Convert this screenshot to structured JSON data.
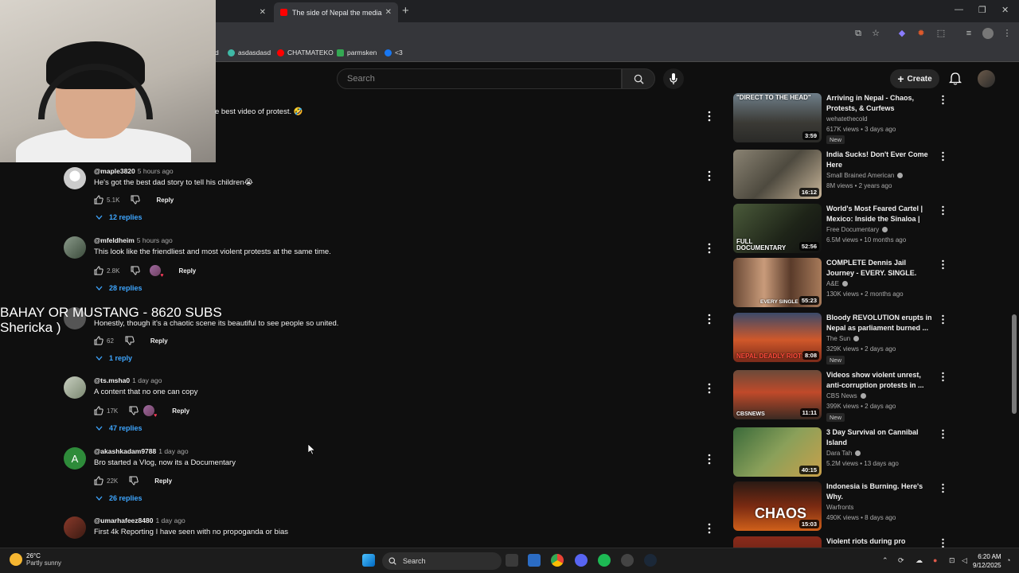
{
  "browser": {
    "tabs": [
      {
        "title": "",
        "active": false
      },
      {
        "title": "The side of Nepal the media w",
        "active": true
      }
    ],
    "bookmarks": [
      {
        "label": "d"
      },
      {
        "label": "asdasdasd"
      },
      {
        "label": "CHATMATEKO"
      },
      {
        "label": "parmsken"
      },
      {
        "label": "<3"
      }
    ]
  },
  "youtube": {
    "search_placeholder": "Search",
    "create_label": "Create"
  },
  "overlay": {
    "line1": "BAHAY OR MUSTANG - 8620 SUBS",
    "line2": "Shericka )"
  },
  "comments": [
    {
      "handle": "",
      "time": "",
      "text": "e best video of protest. 🤣",
      "likes": "",
      "replies": ""
    },
    {
      "handle": "@maple3820",
      "time": "5 hours ago",
      "text": "He's got the best dad story to tell his children😭",
      "likes": "5.1K",
      "replies": "12 replies"
    },
    {
      "handle": "@mfeldheim",
      "time": "5 hours ago",
      "text": "This look like the friendliest and most violent protests at the same time.",
      "likes": "2.8K",
      "replies": "28 replies"
    },
    {
      "handle": "",
      "time": "",
      "text": "Honestly, though it's a chaotic scene its beautiful to see people so united.",
      "likes": "62",
      "replies": "1 reply"
    },
    {
      "handle": "@ts.msha0",
      "time": "1 day ago",
      "text": "A content that no one can copy",
      "likes": "17K",
      "replies": "47 replies"
    },
    {
      "handle": "@akashkadam9788",
      "time": "1 day ago",
      "text": "Bro started a Vlog, now its a Documentary",
      "likes": "22K",
      "replies": "26 replies"
    },
    {
      "handle": "@umarhafeez8480",
      "time": "1 day ago",
      "text": "First 4k Reporting I have seen with no propoganda or bias",
      "likes": "",
      "replies": ""
    }
  ],
  "reply_label": "Reply",
  "sidebar_videos": [
    {
      "title": "Arriving in Nepal - Chaos, Protests, & Curfews",
      "channel": "wehatethecold",
      "meta": "617K views • 3 days ago",
      "new": "New",
      "duration": "3:59",
      "caption": "\"DIRECT TO THE HEAD\""
    },
    {
      "title": "India Sucks! Don't Ever Come Here",
      "channel": "Small Brained American",
      "meta": "8M views • 2 years ago",
      "new": "",
      "duration": "16:12",
      "caption": ""
    },
    {
      "title": "World's Most Feared Cartel | Mexico: Inside the Sinaloa | Fr...",
      "channel": "Free Documentary",
      "meta": "6.5M views • 10 months ago",
      "new": "",
      "duration": "52:56",
      "caption": "FULL DOCUMENTARY"
    },
    {
      "title": "COMPLETE Dennis Jail Journey - EVERY. SINGLE. SCENE. - Par...",
      "channel": "A&E",
      "meta": "130K views • 2 months ago",
      "new": "",
      "duration": "55:23",
      "caption": "EVERY SINGLE"
    },
    {
      "title": "Bloody REVOLUTION erupts in Nepal as parliament burned ...",
      "channel": "The Sun",
      "meta": "329K views • 2 days ago",
      "new": "New",
      "duration": "8:08",
      "caption": "NEPAL DEADLY RIOTS"
    },
    {
      "title": "Videos show violent unrest, anti-corruption protests in ...",
      "channel": "CBS News",
      "meta": "399K views • 2 days ago",
      "new": "New",
      "duration": "11:11",
      "caption": "CBSNEWS"
    },
    {
      "title": "3 Day Survival on Cannibal Island",
      "channel": "Dara Tah",
      "meta": "5.2M views • 13 days ago",
      "new": "",
      "duration": "40:15",
      "caption": ""
    },
    {
      "title": "Indonesia is Burning. Here's Why.",
      "channel": "Warfronts",
      "meta": "490K views • 8 days ago",
      "new": "",
      "duration": "15:03",
      "caption": "CHAOS"
    },
    {
      "title": "Violent riots during pro",
      "channel": "",
      "meta": "",
      "new": "",
      "duration": "",
      "caption": ""
    }
  ],
  "taskbar": {
    "temp": "26°C",
    "weather": "Partly sunny",
    "search": "Search",
    "time": "6:20 AM",
    "date": "9/12/2025"
  }
}
